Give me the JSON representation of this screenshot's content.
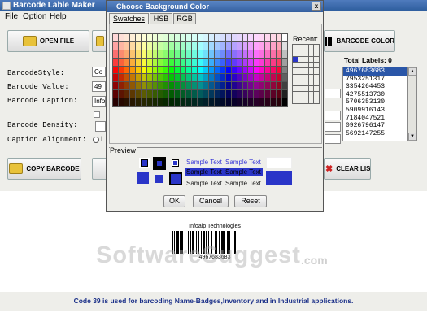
{
  "window": {
    "title": "Barcode Lable Maker"
  },
  "menu": [
    "File",
    "Option",
    "Help"
  ],
  "toolbar": {
    "open_file": "OPEN FILE",
    "barcode_color": "BARCODE COLOR",
    "copy_barcode": "COPY BARCODE",
    "clear_list": "CLEAR LIST"
  },
  "form": {
    "style_label": "BarcodeStyle:",
    "style_value": "Co",
    "value_label": "Barcode Value:",
    "value_value": "49",
    "caption_label": "Barcode Caption:",
    "caption_value": "Info",
    "density_label": "Barcode Density:",
    "alignment_label": "Caption Alignment:",
    "alignment_option": "L"
  },
  "labels": {
    "title": "Total Labels: 0",
    "items": [
      "4967683683",
      "7953251317",
      "3354264453",
      "4275513730",
      "5706353130",
      "5909916143",
      "7184047521",
      "0926796147",
      "5692147255"
    ]
  },
  "dialog": {
    "title": "Choose Background Color",
    "tabs": [
      "Swatches",
      "HSB",
      "RGB"
    ],
    "recent_label": "Recent:",
    "preview_label": "Preview",
    "sample_text": "Sample Text",
    "ok": "OK",
    "cancel": "Cancel",
    "reset": "Reset",
    "close": "x",
    "selected_color": "#2a35c8"
  },
  "output": {
    "caption": "Infoalp Technologies",
    "number": "4967683683"
  },
  "watermark": {
    "main": "SoftwareSuggest",
    "suffix": ".com"
  },
  "info_text": "Code 39 is used for barcoding Name-Badges,Inventory and in Industrial applications."
}
